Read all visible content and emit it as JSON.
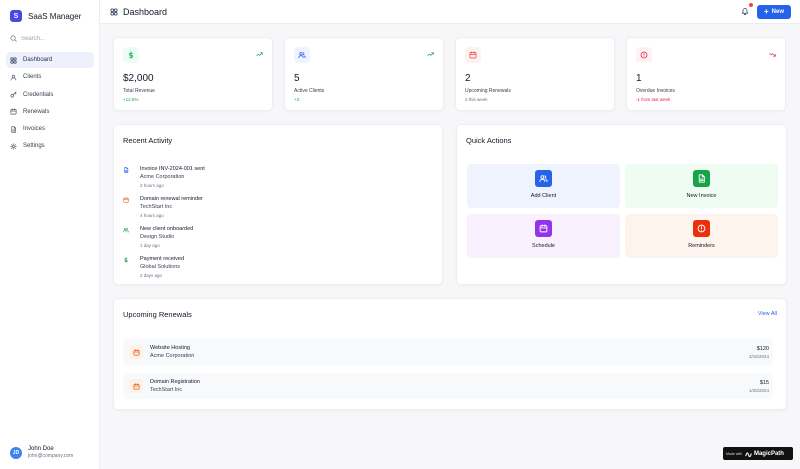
{
  "brand": {
    "logo_letter": "S",
    "name": "SaaS Manager"
  },
  "search": {
    "placeholder": "Search..."
  },
  "sidebar": {
    "items": [
      {
        "label": "Dashboard",
        "icon": "grid-icon",
        "active": true
      },
      {
        "label": "Clients",
        "icon": "user-icon"
      },
      {
        "label": "Credentials",
        "icon": "key-icon"
      },
      {
        "label": "Renewals",
        "icon": "calendar-icon"
      },
      {
        "label": "Invoices",
        "icon": "file-icon"
      },
      {
        "label": "Settings",
        "icon": "gear-icon"
      }
    ]
  },
  "user": {
    "initials": "JD",
    "name": "John Doe",
    "email": "john@company.com"
  },
  "header": {
    "title": "Dashboard",
    "new_label": "New"
  },
  "stats": [
    {
      "value": "$2,000",
      "label": "Total Revenue",
      "sub": "+12.5%",
      "icon": "dollar-icon",
      "color": "#16a34a",
      "bg": "#ecfdf3",
      "trend": "trend-up-icon"
    },
    {
      "value": "5",
      "label": "Active Clients",
      "sub": "+3",
      "icon": "users-icon",
      "color": "#2563eb",
      "bg": "#eff4ff",
      "trend": "trend-up-icon"
    },
    {
      "value": "2",
      "label": "Upcoming Renewals",
      "sub": "2 this week",
      "icon": "calendar-icon",
      "color": "#ef4444",
      "bg": "#fdf2ef",
      "trend": ""
    },
    {
      "value": "1",
      "label": "Overdue Invoices",
      "sub": "-1 from last week",
      "icon": "alert-icon",
      "color": "#e11d48",
      "bg": "#fdf2f4",
      "trend": "trend-down-icon"
    }
  ],
  "recent_activity": {
    "title": "Recent Activity",
    "items": [
      {
        "title": "Invoice INV-2024-001 sent",
        "subject": "Acme Corporation",
        "time": "2 hours ago",
        "icon": "file-icon",
        "color": "#2563eb"
      },
      {
        "title": "Domain renewal reminder",
        "subject": "TechStart Inc",
        "time": "4 hours ago",
        "icon": "calendar-icon",
        "color": "#ea580c"
      },
      {
        "title": "New client onboarded",
        "subject": "Design Studio",
        "time": "1 day ago",
        "icon": "users-icon",
        "color": "#16a34a"
      },
      {
        "title": "Payment received",
        "subject": "Global Solutions",
        "time": "2 days ago",
        "icon": "dollar-icon",
        "color": "#16a34a"
      }
    ]
  },
  "quick_actions": {
    "title": "Quick Actions",
    "items": [
      {
        "label": "Add Client",
        "icon": "users-icon",
        "color": "#2563eb",
        "bg": "#eef3fd"
      },
      {
        "label": "New Invoice",
        "icon": "file-icon",
        "color": "#16a34a",
        "bg": "#eefcf2"
      },
      {
        "label": "Schedule",
        "icon": "calendar-icon",
        "color": "#9333ea",
        "bg": "#f9f2fe"
      },
      {
        "label": "Reminders",
        "icon": "alert-icon",
        "color": "#ea2f0c",
        "bg": "#fef4ee"
      }
    ]
  },
  "upcoming_renewals": {
    "title": "Upcoming Renewals",
    "view_all": "View All",
    "items": [
      {
        "service": "Website Hosting",
        "client": "Acme Corporation",
        "amount": "$120",
        "date": "2/15/2024"
      },
      {
        "service": "Domain Registration",
        "client": "TechStart Inc",
        "amount": "$15",
        "date": "1/25/2024"
      }
    ]
  },
  "watermark": {
    "small": "Made with",
    "big": "MagicPath"
  }
}
